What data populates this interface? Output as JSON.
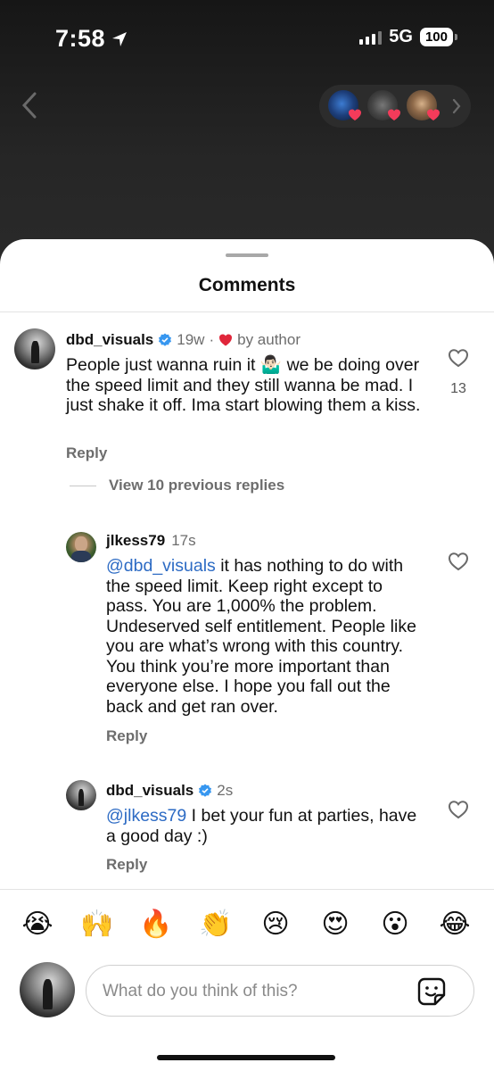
{
  "status_bar": {
    "time": "7:58",
    "network": "5G",
    "battery": "100"
  },
  "sheet": {
    "title": "Comments"
  },
  "comments": [
    {
      "username": "dbd_visuals",
      "time": "19w",
      "separator": "·",
      "author_liked": "by author",
      "text": "People just wanna ruin it 🤷🏻‍♂️ we be doing over the speed limit and they still wanna be mad. I just shake it off. Ima start blowing them a kiss.",
      "likes": "13",
      "reply_label": "Reply"
    }
  ],
  "view_replies": "View 10 previous replies",
  "replies": [
    {
      "username": "jlkess79",
      "time": "17s",
      "mention": "@dbd_visuals",
      "text": " it has nothing to do with the speed limit. Keep right except to pass. You are 1,000% the problem. Undeserved self entitlement. People like you are what’s wrong with this country. You think you’re more important than everyone else. I hope you fall out the back and get ran over.",
      "reply_label": "Reply"
    },
    {
      "username": "dbd_visuals",
      "time": "2s",
      "mention": "@jlkess79",
      "text": " I bet your fun at parties, have a good day :)",
      "reply_label": "Reply"
    }
  ],
  "emoji_reactions": [
    "😭",
    "🙌",
    "🔥",
    "👏",
    "😢",
    "😍",
    "😮",
    "😂"
  ],
  "composer": {
    "placeholder": "What do you think of this?"
  },
  "colors": {
    "mention": "#2d6bc4",
    "like_heart": "#e0263a",
    "verified": "#3797f0"
  }
}
